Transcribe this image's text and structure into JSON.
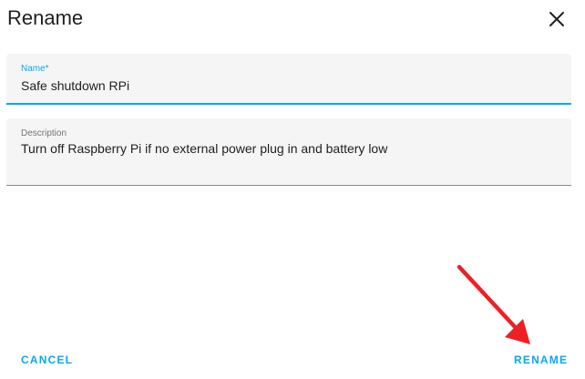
{
  "dialog": {
    "title": "Rename",
    "close_icon": "close-icon"
  },
  "name_field": {
    "label": "Name*",
    "value": "Safe shutdown RPi"
  },
  "description_field": {
    "label": "Description",
    "value": "Turn off Raspberry Pi if no external power plug in and battery low"
  },
  "actions": {
    "cancel_label": "CANCEL",
    "rename_label": "RENAME"
  },
  "colors": {
    "accent": "#03a9f4",
    "annotation_arrow": "#ee2024",
    "field_background": "#f5f5f5"
  }
}
